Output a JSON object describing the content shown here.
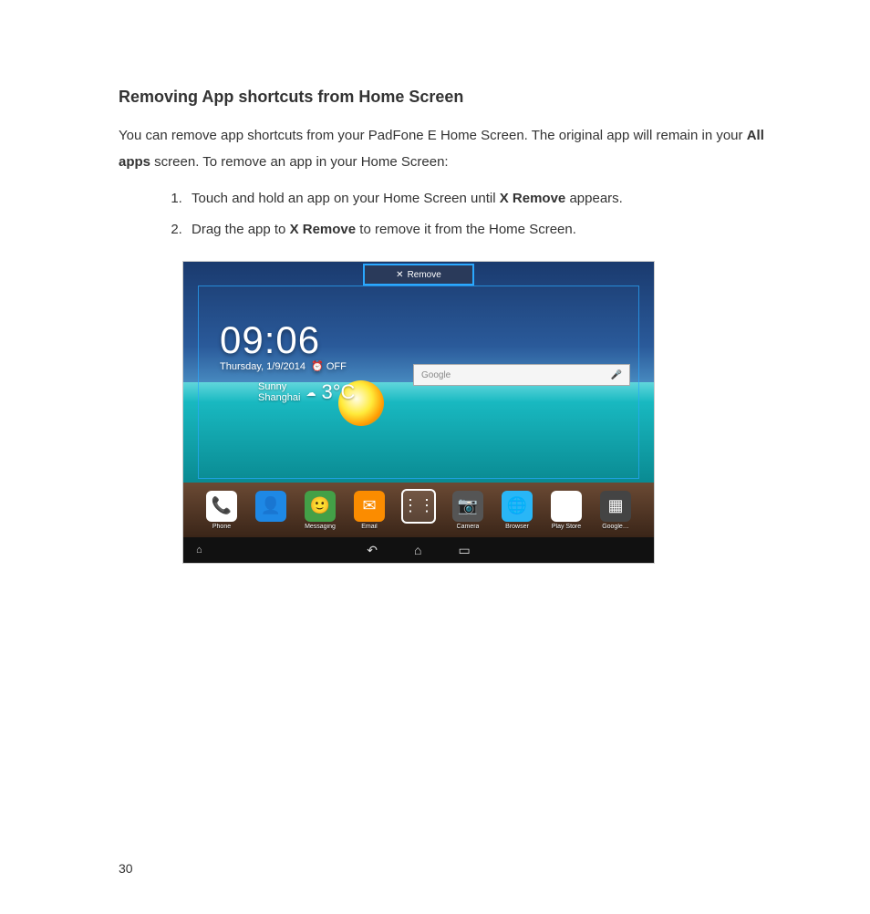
{
  "heading": "Removing App shortcuts from Home Screen",
  "para": {
    "p1a": "You can remove app shortcuts from your PadFone E Home Screen. The original app will remain in your ",
    "p1b": "All apps",
    "p1c": " screen. To remove an app in your Home Screen:"
  },
  "steps": {
    "s1a": "Touch and hold an app on your Home Screen until ",
    "s1b": "X Remove",
    "s1c": " appears.",
    "s2a": "Drag the app to ",
    "s2b": "X Remove",
    "s2c": " to remove it from the Home Screen."
  },
  "pageNumber": "30",
  "screenshot": {
    "removeLabel": "Remove",
    "clockTime": "09:06",
    "clockDate": "Thursday, 1/9/2014",
    "clockAlarm": "OFF",
    "weatherCity": "Shanghai",
    "weatherCond": "Sunny",
    "weatherTemp": "3°C",
    "searchPlaceholder": "Google",
    "dock": [
      {
        "label": "Phone"
      },
      {
        "label": " "
      },
      {
        "label": "Messaging"
      },
      {
        "label": "Email"
      },
      {
        "label": " "
      },
      {
        "label": "Camera"
      },
      {
        "label": "Browser"
      },
      {
        "label": "Play Store"
      },
      {
        "label": "Google…"
      }
    ]
  }
}
